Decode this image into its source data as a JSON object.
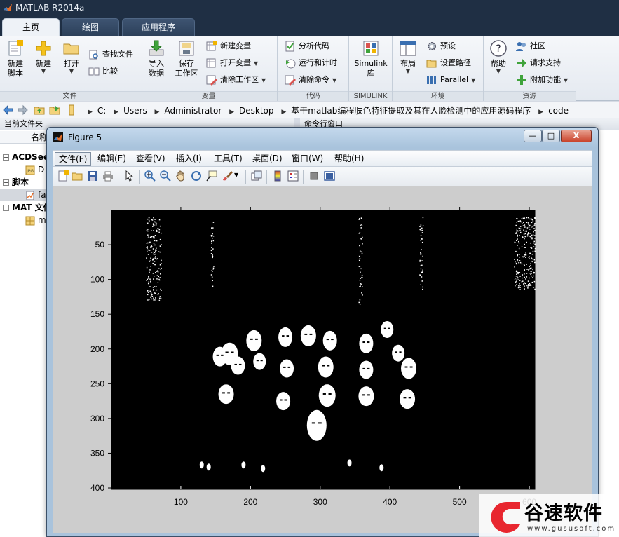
{
  "app": {
    "title": "MATLAB R2014a"
  },
  "tabs": [
    {
      "label": "主页",
      "active": true
    },
    {
      "label": "绘图",
      "active": false
    },
    {
      "label": "应用程序",
      "active": false
    }
  ],
  "ribbon": {
    "file": {
      "label": "文件",
      "new_script": [
        "新建",
        "脚本"
      ],
      "new": "新建",
      "open": "打开",
      "find_files": "查找文件",
      "compare": "比较"
    },
    "variable": {
      "label": "变量",
      "import": [
        "导入",
        "数据"
      ],
      "save": [
        "保存",
        "工作区"
      ],
      "new_var": "新建变量",
      "open_var": "打开变量",
      "clear_ws": "清除工作区"
    },
    "code": {
      "label": "代码",
      "analyze": "分析代码",
      "run_time": "运行和计时",
      "clear_cmd": "清除命令"
    },
    "simulink": {
      "label": "SIMULINK",
      "lib": [
        "Simulink",
        "库"
      ]
    },
    "env": {
      "label": "环境",
      "layout": "布局",
      "prefs": "预设",
      "set_path": "设置路径",
      "parallel": "Parallel"
    },
    "resources": {
      "label": "资源",
      "help": "帮助",
      "community": "社区",
      "support": "请求支持",
      "addons": "附加功能"
    }
  },
  "path": {
    "crumbs": [
      "C:",
      "Users",
      "Administrator",
      "Desktop",
      "基于matlab编程肤色特征提取及其在人脸检测中的应用源码程序",
      "code"
    ]
  },
  "panels": {
    "current_folder": "当前文件夹",
    "command_window": "命令行窗口",
    "name_col": "名称"
  },
  "tree": [
    {
      "label": "ACDSee",
      "bold": true,
      "type": "group"
    },
    {
      "label": "D",
      "bold": false,
      "type": "jpg"
    },
    {
      "label": "脚本",
      "bold": true,
      "type": "group"
    },
    {
      "label": "fa",
      "bold": false,
      "type": "m",
      "selected": true
    },
    {
      "label": "MAT 文件",
      "bold": true,
      "type": "group"
    },
    {
      "label": "m",
      "bold": false,
      "type": "mat"
    }
  ],
  "figure": {
    "title": "Figure 5",
    "menus": [
      "文件(F)",
      "编辑(E)",
      "查看(V)",
      "插入(I)",
      "工具(T)",
      "桌面(D)",
      "窗口(W)",
      "帮助(H)"
    ],
    "window_buttons": {
      "minimize": "—",
      "maximize": "□",
      "close": "X"
    }
  },
  "chart_data": {
    "type": "heatmap",
    "title": "",
    "xlabel": "",
    "ylabel": "",
    "xlim": [
      0.5,
      608
    ],
    "ylim": [
      0.5,
      402
    ],
    "y_reversed": true,
    "xticks": [
      100,
      200,
      300,
      400,
      500,
      600
    ],
    "yticks": [
      50,
      100,
      150,
      200,
      250,
      300,
      350,
      400
    ],
    "colormap": [
      "#000000",
      "#ffffff"
    ],
    "face_blobs": [
      [
        170,
        207,
        12,
        16
      ],
      [
        205,
        188,
        11,
        15
      ],
      [
        250,
        183,
        10,
        14
      ],
      [
        283,
        181,
        11,
        15
      ],
      [
        314,
        188,
        10,
        14
      ],
      [
        366,
        192,
        10,
        14
      ],
      [
        396,
        172,
        9,
        12
      ],
      [
        412,
        206,
        9,
        12
      ],
      [
        156,
        211,
        10,
        14
      ],
      [
        182,
        224,
        10,
        13
      ],
      [
        213,
        218,
        9,
        12
      ],
      [
        252,
        228,
        10,
        13
      ],
      [
        308,
        226,
        11,
        15
      ],
      [
        366,
        230,
        10,
        13
      ],
      [
        427,
        228,
        11,
        15
      ],
      [
        165,
        265,
        11,
        14
      ],
      [
        247,
        275,
        10,
        13
      ],
      [
        310,
        267,
        12,
        16
      ],
      [
        366,
        268,
        11,
        14
      ],
      [
        425,
        272,
        11,
        14
      ],
      [
        295,
        310,
        14,
        22
      ]
    ]
  },
  "watermark": {
    "text": "谷速软件",
    "url": "www.gususoft.com"
  }
}
